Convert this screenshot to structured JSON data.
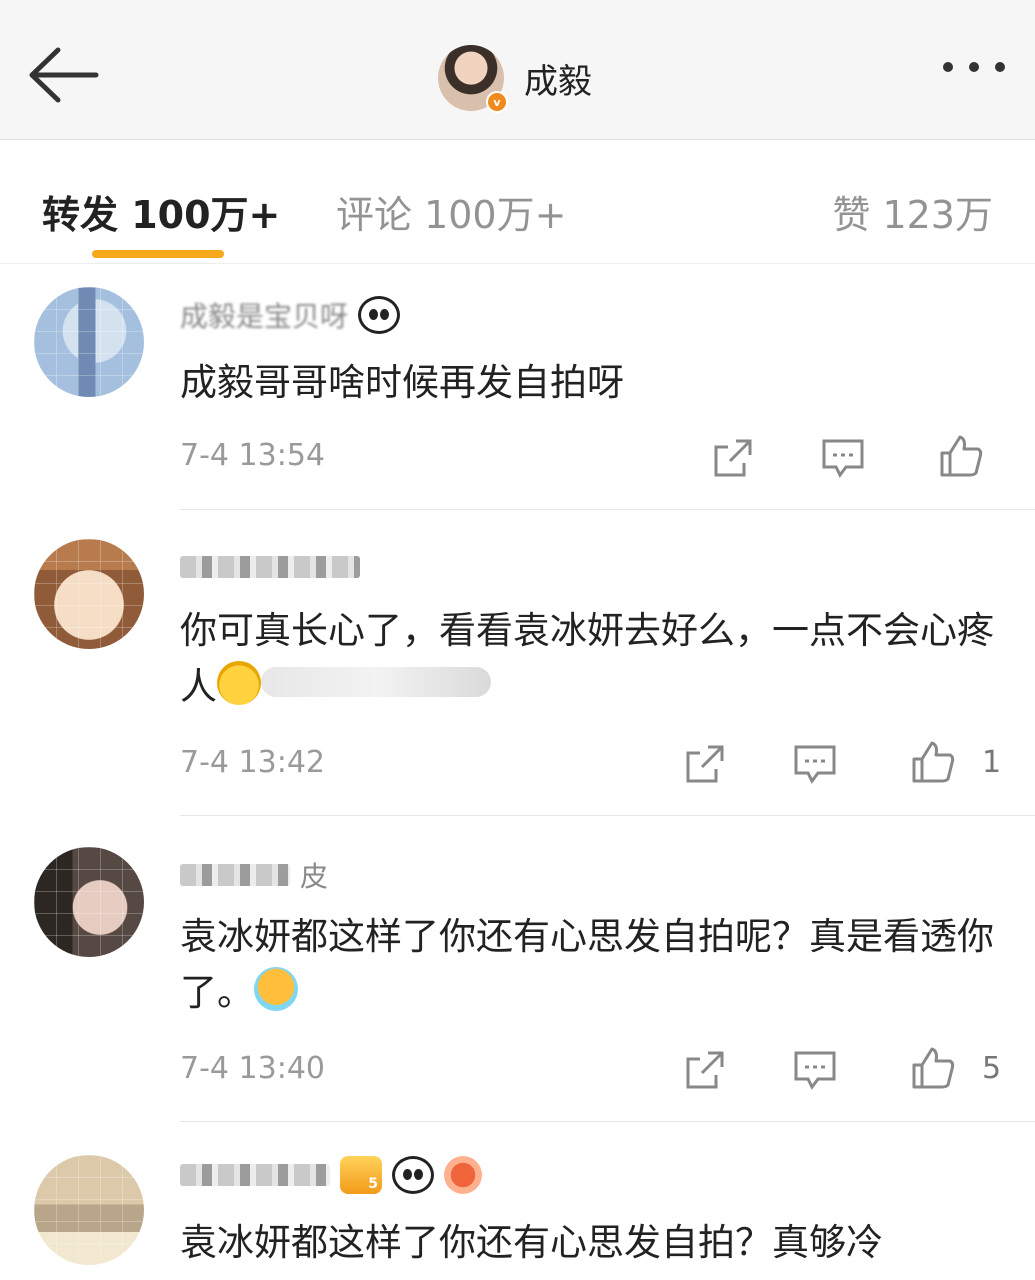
{
  "header": {
    "title": "成毅",
    "avatar_badge": "v"
  },
  "tabs": [
    {
      "label": "转发 100万+"
    },
    {
      "label": "评论 100万+"
    },
    {
      "label": "赞 123万"
    }
  ],
  "comments": [
    {
      "username": "成毅是宝贝呀",
      "text": "成毅哥哥啥时候再发自拍呀",
      "time": "7-4 13:54",
      "likes": ""
    },
    {
      "username": "",
      "text": "你可真长心了，看看袁冰妍去好么，一点不会心疼人",
      "time": "7-4 13:42",
      "likes": "1"
    },
    {
      "username": "皮",
      "text": "袁冰妍都这样了你还有心思发自拍呢？真是看透你了。",
      "time": "7-4 13:40",
      "likes": "5"
    },
    {
      "username": "",
      "badge_text": "5",
      "text": "袁冰妍都这样了你还有心思发自拍？真够冷",
      "time": "",
      "likes": ""
    }
  ],
  "colors": {
    "accent": "#f7a81b",
    "verified": "#f08a1c",
    "muted_text": "#939393"
  },
  "icons": {
    "back": "arrow-left-icon",
    "more": "more-icon",
    "repost": "repost-icon",
    "comment": "comment-icon",
    "like": "thumbs-up-icon"
  }
}
